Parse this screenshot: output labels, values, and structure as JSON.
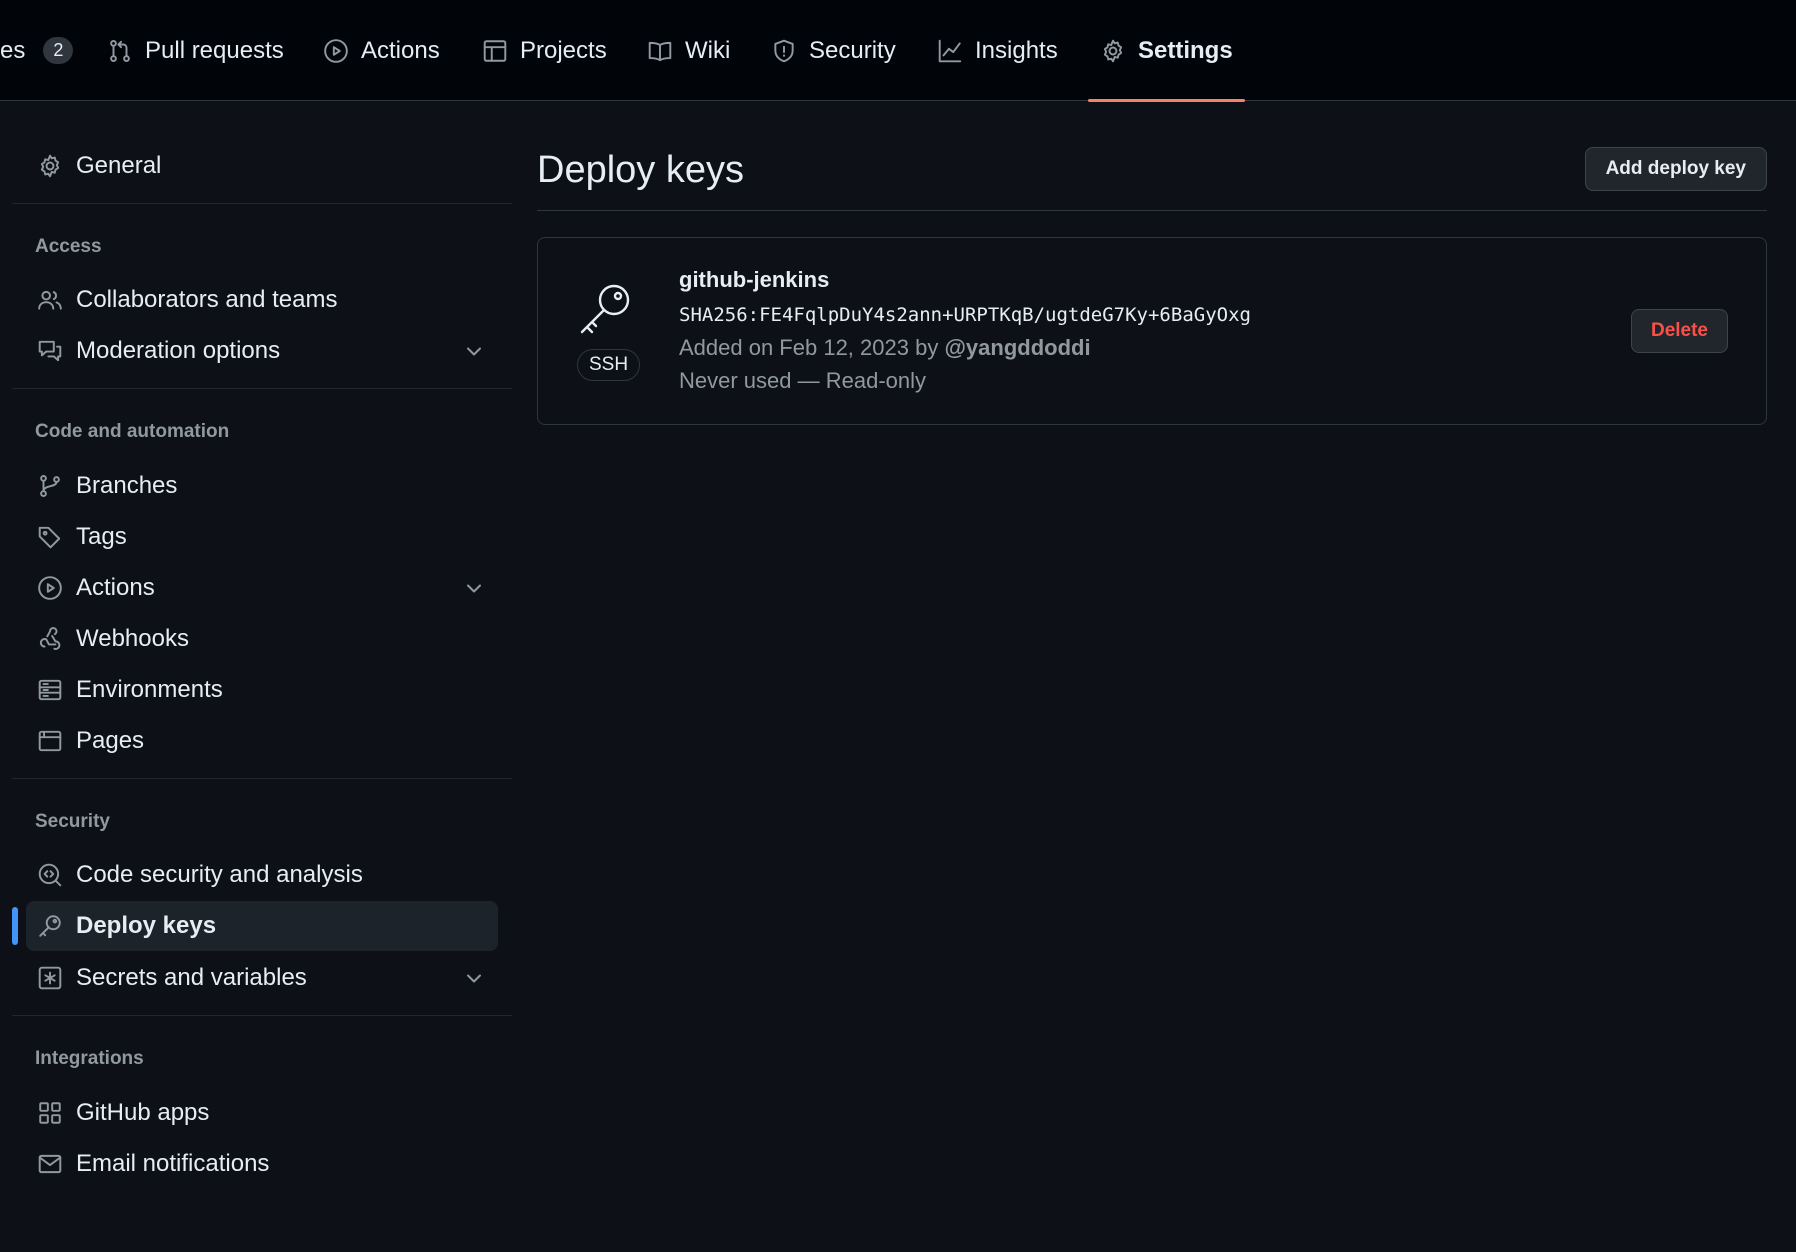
{
  "topnav": {
    "tabs": [
      {
        "label": "es",
        "counter": "2"
      },
      {
        "label": "Pull requests"
      },
      {
        "label": "Actions"
      },
      {
        "label": "Projects"
      },
      {
        "label": "Wiki"
      },
      {
        "label": "Security"
      },
      {
        "label": "Insights"
      },
      {
        "label": "Settings",
        "selected": true
      }
    ]
  },
  "sidebar": {
    "general": "General",
    "sections": {
      "access": "Access",
      "code": "Code and automation",
      "security": "Security",
      "integrations": "Integrations"
    },
    "items": {
      "collaborators": "Collaborators and teams",
      "moderation": "Moderation options",
      "branches": "Branches",
      "tags": "Tags",
      "actions": "Actions",
      "webhooks": "Webhooks",
      "environments": "Environments",
      "pages": "Pages",
      "code_security": "Code security and analysis",
      "deploy_keys": "Deploy keys",
      "secrets": "Secrets and variables",
      "github_apps": "GitHub apps",
      "email": "Email notifications"
    },
    "active_item": "deploy_keys"
  },
  "main": {
    "title": "Deploy keys",
    "add_button": "Add deploy key",
    "key": {
      "type_badge": "SSH",
      "name": "github-jenkins",
      "fingerprint": "SHA256:FE4FqlpDuY4s2ann+URPTKqB/ugtdeG7Ky+6BaGyOxg",
      "added_prefix": "Added on Feb 12, 2023 by",
      "added_by": "@yangddoddi",
      "usage": "Never used — Read-only",
      "delete_button": "Delete"
    }
  },
  "colors": {
    "background": "#0d1117",
    "accent_underline": "#f78166",
    "active_indicator": "#4493f8",
    "danger": "#f85149"
  }
}
